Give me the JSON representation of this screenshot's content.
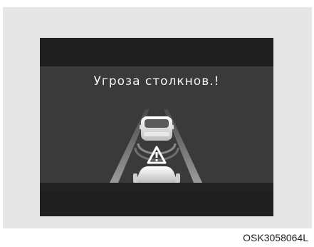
{
  "display": {
    "warning_message": "Угроза столкнов.!",
    "icons": {
      "lead_vehicle": "car-rear-icon",
      "own_vehicle": "car-hood-icon",
      "warning": "warning-triangle-icon",
      "radar": "radar-wave-icon",
      "lanes": "road-lane-icon"
    }
  },
  "caption": {
    "code": "OSK3058064L"
  },
  "colors": {
    "panel_background": "#e6e6e6",
    "display_dark": "#1f1f1f",
    "screen_background": "#3a3a3a",
    "text": "#f2f2f2"
  }
}
